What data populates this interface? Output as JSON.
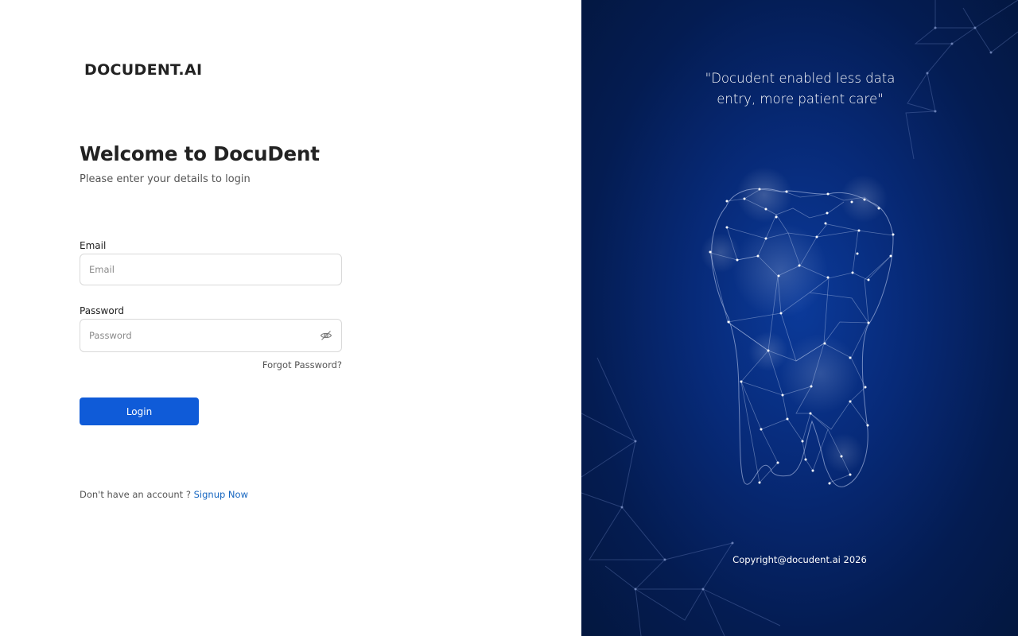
{
  "brand": {
    "logo_text": "DOCUDENT.AI"
  },
  "login": {
    "heading": "Welcome to DocuDent",
    "subheading": "Please enter your details to login",
    "email_label": "Email",
    "email_placeholder": "Email",
    "email_value": "",
    "password_label": "Password",
    "password_placeholder": "Password",
    "password_value": "",
    "forgot_password": "Forgot Password?",
    "login_button": "Login",
    "signup_prompt": "Don't have an account ?",
    "signup_link": "Signup Now"
  },
  "hero": {
    "quote": "\"Docudent enabled less data entry, more patient care\"",
    "copyright": "Copyright@docudent.ai 2026",
    "illustration_icon": "tooth-network-icon"
  },
  "colors": {
    "primary_button": "#0f5bd8",
    "link": "#1565c0",
    "panel_dark": "#041c52",
    "panel_glow": "#0b3a9a"
  },
  "icons": {
    "password_toggle": "eye-slash-icon"
  }
}
